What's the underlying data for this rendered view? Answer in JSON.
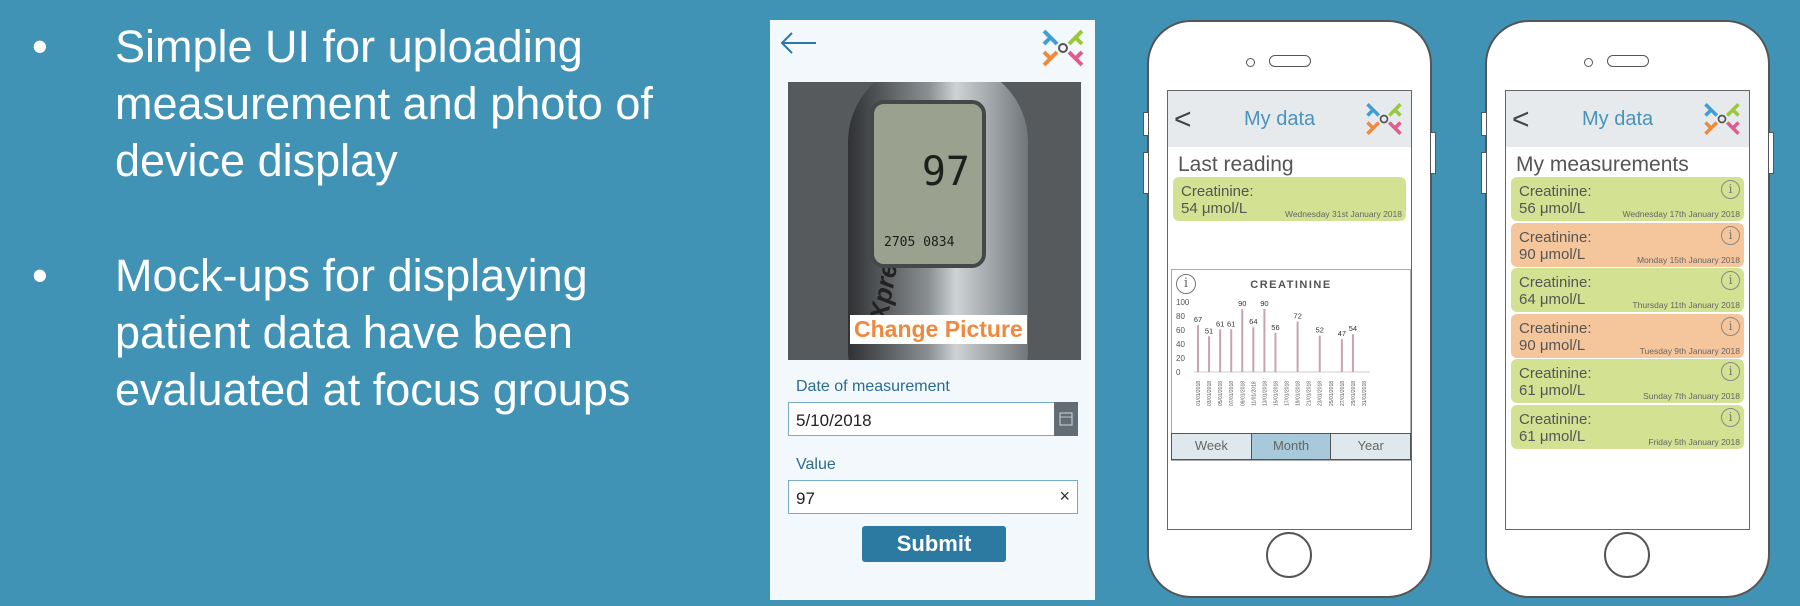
{
  "slide": {
    "bullets": [
      {
        "marker": "•",
        "text": "Simple UI for uploading measurement and photo of device display"
      },
      {
        "marker": "•",
        "text": "Mock-ups for displaying patient data have been evaluated at focus groups"
      }
    ]
  },
  "upload_screen": {
    "photo": {
      "display_value": "97",
      "display_date": "2705  0834",
      "device_brand": "Xpress"
    },
    "change_picture_label": "Change Picture",
    "date_label": "Date of measurement",
    "date_value": "5/10/2018",
    "value_label": "Value",
    "value_input": "97",
    "clear_symbol": "×",
    "submit_label": "Submit"
  },
  "phone_chart": {
    "title": "My data",
    "back_symbol": "<",
    "subtitle": "Last reading",
    "last_reading": {
      "label": "Creatinine:",
      "value": "54 μmol/L",
      "date": "Wednesday 31st January 2018"
    },
    "info_symbol": "i",
    "tabs": [
      "Week",
      "Month",
      "Year"
    ],
    "active_tab": "Month",
    "chart_data": {
      "type": "bar",
      "title": "CREATININE",
      "categories": [
        "01/01/2018",
        "03/01/2018",
        "05/01/2018",
        "07/01/2018",
        "09/01/2018",
        "11/01/2018",
        "13/01/2018",
        "15/01/2018",
        "17/01/2018",
        "19/01/2018",
        "21/01/2018",
        "23/01/2018",
        "25/01/2018",
        "27/01/2018",
        "29/01/2018",
        "31/01/2018"
      ],
      "values": [
        67,
        51,
        61,
        61,
        90,
        64,
        90,
        56,
        null,
        72,
        null,
        52,
        null,
        47,
        54,
        null
      ],
      "data_labels": [
        "67",
        "51",
        "61",
        "61",
        "90",
        "64",
        "90",
        "56",
        "",
        "72",
        "",
        "52",
        "",
        "47",
        "54",
        ""
      ],
      "yticks": [
        "100",
        "80",
        "60",
        "40",
        "20",
        "0"
      ],
      "ylim": [
        0,
        100
      ],
      "bar_color": "#c9a3b0"
    }
  },
  "phone_list": {
    "title": "My data",
    "back_symbol": "<",
    "subtitle": "My measurements",
    "info_symbol": "i",
    "items": [
      {
        "label": "Creatinine:",
        "value": "56 μmol/L",
        "date": "Wednesday 17th January 2018",
        "status": "green"
      },
      {
        "label": "Creatinine:",
        "value": "90 μmol/L",
        "date": "Monday 15th January 2018",
        "status": "orange"
      },
      {
        "label": "Creatinine:",
        "value": "64 μmol/L",
        "date": "Thursday 11th January 2018",
        "status": "green"
      },
      {
        "label": "Creatinine:",
        "value": "90 μmol/L",
        "date": "Tuesday 9th January 2018",
        "status": "orange"
      },
      {
        "label": "Creatinine:",
        "value": "61 μmol/L",
        "date": "Sunday 7th January 2018",
        "status": "green"
      },
      {
        "label": "Creatinine:",
        "value": "61 μmol/L",
        "date": "Friday 5th January 2018",
        "status": "green"
      }
    ]
  },
  "colors": {
    "background": "#4193b5",
    "green_card": "#d3e193",
    "orange_card": "#f5c69c",
    "accent": "#2c79a2"
  },
  "icons": [
    "back-arrow-icon",
    "logo-x-icon",
    "calendar-icon",
    "clear-icon",
    "info-icon",
    "chevron-left-icon"
  ]
}
